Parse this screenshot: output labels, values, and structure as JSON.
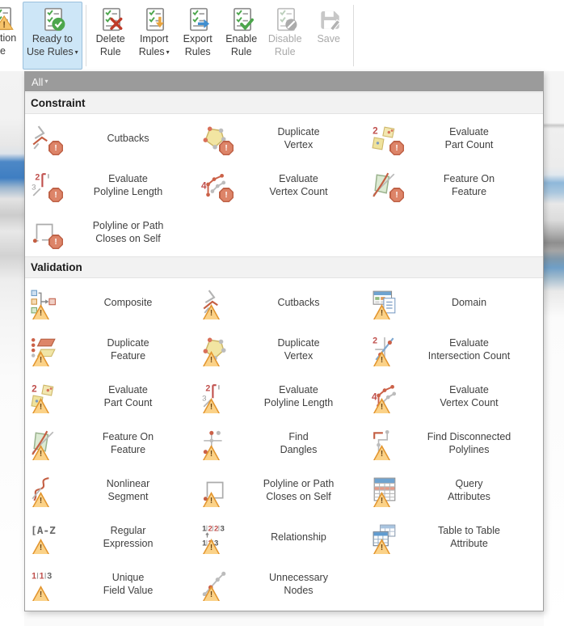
{
  "glyphs": {
    "dropdown_arrow": "▾",
    "exclamation": "!"
  },
  "colors": {
    "selected_button_bg": "#cde6f7",
    "selected_button_border": "#9ac0dd",
    "filter_bar_bg": "#9b9b9b",
    "section_header_bg": "#f2f2f2",
    "constraint_badge_fill": "#dd8468",
    "constraint_badge_border": "#bf6247",
    "validation_badge_fill": "#fbd288",
    "validation_badge_border": "#e2952f"
  },
  "toolbar": {
    "cut_button": {
      "label": "tion\ne",
      "icon": "validation-rule"
    },
    "buttons": [
      {
        "id": "ready-to-use-rules",
        "label": "Ready to\nUse Rules",
        "icon": "ready-rules",
        "dropdown": true,
        "selected": true,
        "enabled": true,
        "separator_before": false
      },
      {
        "id": "delete-rule",
        "label": "Delete\nRule",
        "icon": "delete-rule",
        "dropdown": false,
        "selected": false,
        "enabled": true,
        "separator_before": true
      },
      {
        "id": "import-rules",
        "label": "Import\nRules",
        "icon": "import-rules",
        "dropdown": true,
        "selected": false,
        "enabled": true,
        "separator_before": false
      },
      {
        "id": "export-rules",
        "label": "Export\nRules",
        "icon": "export-rules",
        "dropdown": false,
        "selected": false,
        "enabled": true,
        "separator_before": false
      },
      {
        "id": "enable-rule",
        "label": "Enable\nRule",
        "icon": "enable-rule",
        "dropdown": false,
        "selected": false,
        "enabled": true,
        "separator_before": false
      },
      {
        "id": "disable-rule",
        "label": "Disable\nRule",
        "icon": "disable-rule",
        "dropdown": false,
        "selected": false,
        "enabled": false,
        "separator_before": false
      },
      {
        "id": "save",
        "label": "Save",
        "icon": "save",
        "dropdown": false,
        "selected": false,
        "enabled": false,
        "separator_before": false
      }
    ],
    "trailing_separator": true
  },
  "dropdown": {
    "filter_label": "All",
    "sections": [
      {
        "title": "Constraint",
        "badge": "constraint",
        "items": [
          {
            "label": "Cutbacks",
            "icon": "cutbacks"
          },
          {
            "label": "Duplicate\nVertex",
            "icon": "duplicate-vertex"
          },
          {
            "label": "Evaluate\nPart Count",
            "icon": "evaluate-part-count"
          },
          {
            "label": "Evaluate\nPolyline Length",
            "icon": "evaluate-polyline-length"
          },
          {
            "label": "Evaluate\nVertex Count",
            "icon": "evaluate-vertex-count"
          },
          {
            "label": "Feature On\nFeature",
            "icon": "feature-on-feature"
          },
          {
            "label": "Polyline or Path\nCloses on Self",
            "icon": "polyline-closes-on-self"
          }
        ]
      },
      {
        "title": "Validation",
        "badge": "validation",
        "items": [
          {
            "label": "Composite",
            "icon": "composite"
          },
          {
            "label": "Cutbacks",
            "icon": "cutbacks"
          },
          {
            "label": "Domain",
            "icon": "domain"
          },
          {
            "label": "Duplicate\nFeature",
            "icon": "duplicate-feature"
          },
          {
            "label": "Duplicate\nVertex",
            "icon": "duplicate-vertex"
          },
          {
            "label": "Evaluate\nIntersection Count",
            "icon": "evaluate-intersection-count"
          },
          {
            "label": "Evaluate\nPart Count",
            "icon": "evaluate-part-count"
          },
          {
            "label": "Evaluate\nPolyline Length",
            "icon": "evaluate-polyline-length"
          },
          {
            "label": "Evaluate\nVertex Count",
            "icon": "evaluate-vertex-count"
          },
          {
            "label": "Feature On\nFeature",
            "icon": "feature-on-feature"
          },
          {
            "label": "Find\nDangles",
            "icon": "find-dangles"
          },
          {
            "label": "Find Disconnected\nPolylines",
            "icon": "find-disconnected-polylines"
          },
          {
            "label": "Nonlinear\nSegment",
            "icon": "nonlinear-segment"
          },
          {
            "label": "Polyline or Path\nCloses on Self",
            "icon": "polyline-closes-on-self"
          },
          {
            "label": "Query\nAttributes",
            "icon": "query-attributes"
          },
          {
            "label": "Regular\nExpression",
            "icon": "regular-expression"
          },
          {
            "label": "Relationship",
            "icon": "relationship"
          },
          {
            "label": "Table to Table\nAttribute",
            "icon": "table-to-table-attribute"
          },
          {
            "label": "Unique\nField Value",
            "icon": "unique-field-value"
          },
          {
            "label": "Unnecessary\nNodes",
            "icon": "unnecessary-nodes"
          }
        ]
      }
    ]
  }
}
